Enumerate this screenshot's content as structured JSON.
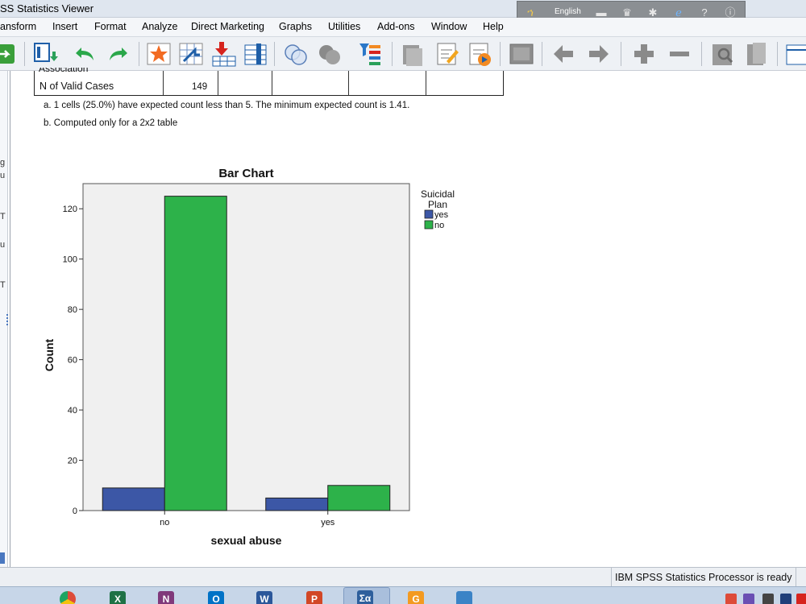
{
  "window": {
    "title": "SS Statistics Viewer"
  },
  "ime": {
    "language": "English"
  },
  "menu": [
    "ansform",
    "Insert",
    "Format",
    "Analyze",
    "Direct Marketing",
    "Graphs",
    "Utilities",
    "Add-ons",
    "Window",
    "Help"
  ],
  "toolbar_icons": [
    "goto-data-icon",
    "export-icon",
    "undo-icon",
    "redo-icon",
    "goto-case-icon",
    "goto-variable-icon",
    "insert-cases-icon",
    "insert-variables-icon",
    "venn-icon",
    "circles-icon",
    "select-cases-icon",
    "designate-window-icon",
    "script-icon",
    "run-script-icon",
    "hide-icon",
    "back-arrow-icon",
    "forward-arrow-icon",
    "expand-icon",
    "collapse-icon",
    "show-icon",
    "insert-page-icon",
    "output-icon"
  ],
  "left_strip_chars": [
    "g",
    "u",
    "T",
    "u",
    "T"
  ],
  "table": {
    "clipped_row": "Association",
    "row_label": "N of Valid Cases",
    "row_value": "149"
  },
  "footnotes": [
    "a. 1 cells (25.0%) have expected count less than 5. The minimum expected count is 1.41.",
    "b. Computed only for a 2x2 table"
  ],
  "chart_data": {
    "type": "bar",
    "title": "Bar Chart",
    "xlabel": "sexual abuse",
    "ylabel": "Count",
    "categories": [
      "no",
      "yes"
    ],
    "series": [
      {
        "name": "yes",
        "values": [
          9,
          5
        ],
        "color": "#3c57a6"
      },
      {
        "name": "no",
        "values": [
          125,
          10
        ],
        "color": "#2db24a"
      }
    ],
    "ylim": [
      0,
      130
    ],
    "yticks": [
      0,
      20,
      40,
      60,
      80,
      100,
      120
    ],
    "legend_title": [
      "Suicidal",
      "Plan"
    ],
    "legend_position": "top-right",
    "plot_background": "#f0f0f0",
    "grid": false
  },
  "status": {
    "text": "IBM SPSS Statistics Processor is ready"
  },
  "taskbar": [
    {
      "name": "chrome-icon",
      "letter": "",
      "color": "#dd4b39"
    },
    {
      "name": "excel-icon",
      "letter": "X",
      "color": "#1e7145"
    },
    {
      "name": "onenote-icon",
      "letter": "N",
      "color": "#80397b"
    },
    {
      "name": "outlook-icon",
      "letter": "O",
      "color": "#0072c6"
    },
    {
      "name": "word-icon",
      "letter": "W",
      "color": "#2b579a"
    },
    {
      "name": "powerpoint-icon",
      "letter": "P",
      "color": "#d24726"
    },
    {
      "name": "spss-icon",
      "letter": "Σα",
      "color": "#2e5f9c"
    },
    {
      "name": "app-orange-icon",
      "letter": "G",
      "color": "#f39a21"
    },
    {
      "name": "picture-viewer-icon",
      "letter": "",
      "color": "#3b83c6"
    }
  ]
}
